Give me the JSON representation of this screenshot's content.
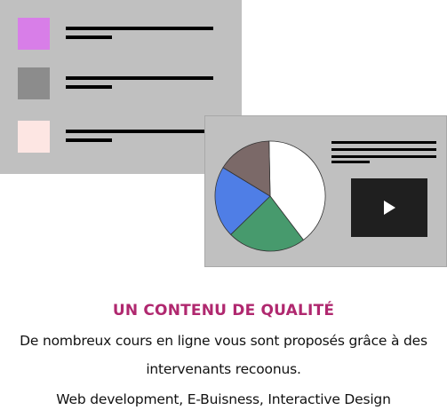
{
  "colors": {
    "panel_bg": "#c0c0c0",
    "title_accent": "#b0286f",
    "swatches": [
      "#d87ee8",
      "#8c8c8c",
      "#fde6e3"
    ],
    "pie": [
      "#ffffff",
      "#479a6d",
      "#4f7ee6",
      "#7b6968"
    ]
  },
  "icons": {
    "play": "play-icon",
    "pie": "pie-chart-icon",
    "swatch": "color-swatch-icon"
  },
  "chart_data": {
    "type": "pie",
    "values": [
      0.4,
      0.23,
      0.21,
      0.16
    ],
    "colors": [
      "#ffffff",
      "#479a6d",
      "#4f7ee6",
      "#7b6968"
    ]
  },
  "section": {
    "title": "UN CONTENU DE QUALITÉ",
    "description_line1": "De nombreux cours en ligne vous sont proposés grâce à des",
    "description_line2": "intervenants recoonus.",
    "description_line3": "Web development, E-Buisness, Interactive Design"
  }
}
